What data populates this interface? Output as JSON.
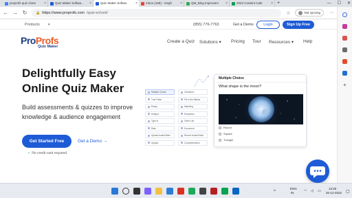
{
  "browser": {
    "tabs": [
      {
        "label": "proprofs quiz clone",
        "color": "#4285f4",
        "active": false
      },
      {
        "label": "Quiz Maker Softwa...",
        "color": "#1e5bd6",
        "active": false
      },
      {
        "label": "Quiz Maker Softwa",
        "color": "#1e5bd6",
        "active": true
      },
      {
        "label": "Inbox (186) - megh",
        "color": "#ea4335",
        "active": false
      },
      {
        "label": "QM_Blog Improvem",
        "color": "#34a853",
        "active": false
      },
      {
        "label": "2022 Content Cale",
        "color": "#0f9d58",
        "active": false
      }
    ],
    "url_host": "https://www.proprofs.com",
    "url_path": "/quiz-school/",
    "sync_label": "Not syncing",
    "win_min": "—",
    "win_max": "☐",
    "win_close": "✕"
  },
  "promo": {
    "products": "Products",
    "phone": "(855) 776-7763",
    "demo": "Get a Demo",
    "login": "Login",
    "signup": "Sign Up Free"
  },
  "nav": {
    "logo_pro": "Pro",
    "logo_profs": "Profs",
    "logo_sub": "Quiz Maker",
    "items": [
      "Create a Quiz",
      "Solutions ▾",
      "Pricing",
      "Tour",
      "Resources ▾",
      "Help"
    ]
  },
  "hero": {
    "title_line1": "Delightfully Easy",
    "title_line2": "Online Quiz Maker",
    "desc_line1": "Build assessments & quizzes to improve",
    "desc_line2": "knowledge & audience engagement",
    "cta": "Get Started Free",
    "demo": "Get a Demo  →",
    "no_cc": "No credit card required."
  },
  "question_types": [
    "Multiple Choice",
    "Checkbox",
    "True False",
    "Fill in the Blanks",
    "Essay",
    "Matching",
    "Hotspot",
    "Dropdown",
    "Type in",
    "Order List",
    "Rate",
    "Document",
    "Upload Audio/Video",
    "Record Audio/Video",
    "Upload",
    "Comprehension"
  ],
  "card": {
    "header": "Multiple Choice",
    "question": "What shape is the moon?",
    "options": [
      "Round",
      "Square",
      "Triangle"
    ]
  },
  "tray": {
    "lang": "ENG",
    "region": "IN",
    "time": "13:26",
    "date": "20-12-2022"
  }
}
